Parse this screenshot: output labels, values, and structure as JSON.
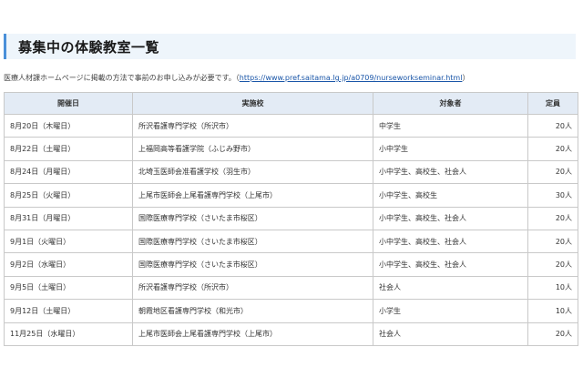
{
  "heading": "募集中の体験教室一覧",
  "note": {
    "prefix": "医療人材課ホームページに掲載の方法で事前のお申し込みが必要です。（",
    "link": "https://www.pref.saitama.lg.jp/a0709/nurseworkseminar.html",
    "suffix": "）"
  },
  "table": {
    "headers": [
      "開催日",
      "実施校",
      "対象者",
      "定員"
    ],
    "rows": [
      {
        "date": "8月20日（木曜日）",
        "school": "所沢看護専門学校（所沢市）",
        "target": "中学生",
        "capacity": "20人"
      },
      {
        "date": "8月22日（土曜日）",
        "school": "上福岡高等看護学院（ふじみ野市）",
        "target": "小中学生",
        "capacity": "20人"
      },
      {
        "date": "8月24日（月曜日）",
        "school": "北埼玉医師会准看護学校（羽生市）",
        "target": "小中学生、高校生、社会人",
        "capacity": "20人"
      },
      {
        "date": "8月25日（火曜日）",
        "school": "上尾市医師会上尾看護専門学校（上尾市）",
        "target": "小中学生、高校生",
        "capacity": "30人"
      },
      {
        "date": "8月31日（月曜日）",
        "school": "国際医療専門学校（さいたま市桜区）",
        "target": "小中学生、高校生、社会人",
        "capacity": "20人"
      },
      {
        "date": "9月1日（火曜日）",
        "school": "国際医療専門学校（さいたま市桜区）",
        "target": "小中学生、高校生、社会人",
        "capacity": "20人"
      },
      {
        "date": "9月2日（水曜日）",
        "school": "国際医療専門学校（さいたま市桜区）",
        "target": "小中学生、高校生、社会人",
        "capacity": "20人"
      },
      {
        "date": "9月5日（土曜日）",
        "school": "所沢看護専門学校（所沢市）",
        "target": "社会人",
        "capacity": "10人"
      },
      {
        "date": "9月12日（土曜日）",
        "school": "朝霞地区看護専門学校（和光市）",
        "target": "小学生",
        "capacity": "10人"
      },
      {
        "date": "11月25日（水曜日）",
        "school": "上尾市医師会上尾看護専門学校（上尾市）",
        "target": "社会人",
        "capacity": "20人"
      }
    ]
  }
}
